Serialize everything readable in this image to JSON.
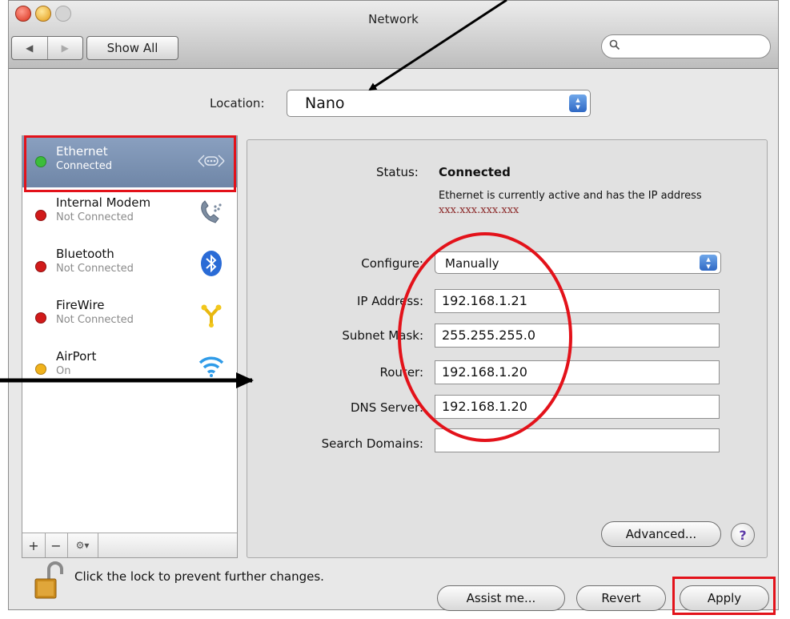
{
  "window": {
    "title": "Network"
  },
  "toolbar": {
    "back_icon": "back-arrow-icon",
    "forward_icon": "forward-arrow-icon",
    "show_all": "Show All",
    "search_placeholder": ""
  },
  "location": {
    "label": "Location:",
    "value": "Nano"
  },
  "services": [
    {
      "name": "Ethernet",
      "status": "Connected",
      "dot": "#3bbd3b",
      "icon": "ethernet-icon",
      "selected": true
    },
    {
      "name": "Internal Modem",
      "status": "Not Connected",
      "dot": "#d11a1a",
      "icon": "modem-icon",
      "selected": false
    },
    {
      "name": "Bluetooth",
      "status": "Not Connected",
      "dot": "#d11a1a",
      "icon": "bluetooth-icon",
      "selected": false
    },
    {
      "name": "FireWire",
      "status": "Not Connected",
      "dot": "#d11a1a",
      "icon": "firewire-icon",
      "selected": false
    },
    {
      "name": "AirPort",
      "status": "On",
      "dot": "#f0b21c",
      "icon": "airport-icon",
      "selected": false
    }
  ],
  "sidebar_toolbar": {
    "add": "+",
    "remove": "−",
    "action": "⚙▾"
  },
  "detail": {
    "status_label": "Status:",
    "status_value": "Connected",
    "status_desc": "Ethernet is currently active and has the IP address",
    "status_ip": "xxx.xxx.xxx.xxx",
    "configure_label": "Configure:",
    "configure_value": "Manually",
    "ip_label": "IP Address:",
    "ip_value": "192.168.1.21",
    "subnet_label": "Subnet Mask:",
    "subnet_value": "255.255.255.0",
    "router_label": "Router:",
    "router_value": "192.168.1.20",
    "dns_label": "DNS Server:",
    "dns_value": "192.168.1.20",
    "search_domains_label": "Search Domains:",
    "search_domains_value": "",
    "advanced": "Advanced...",
    "help": "?"
  },
  "footer": {
    "lock_text": "Click the lock to prevent further changes.",
    "assist": "Assist me...",
    "revert": "Revert",
    "apply": "Apply"
  },
  "annotation_color": "#e3121a"
}
